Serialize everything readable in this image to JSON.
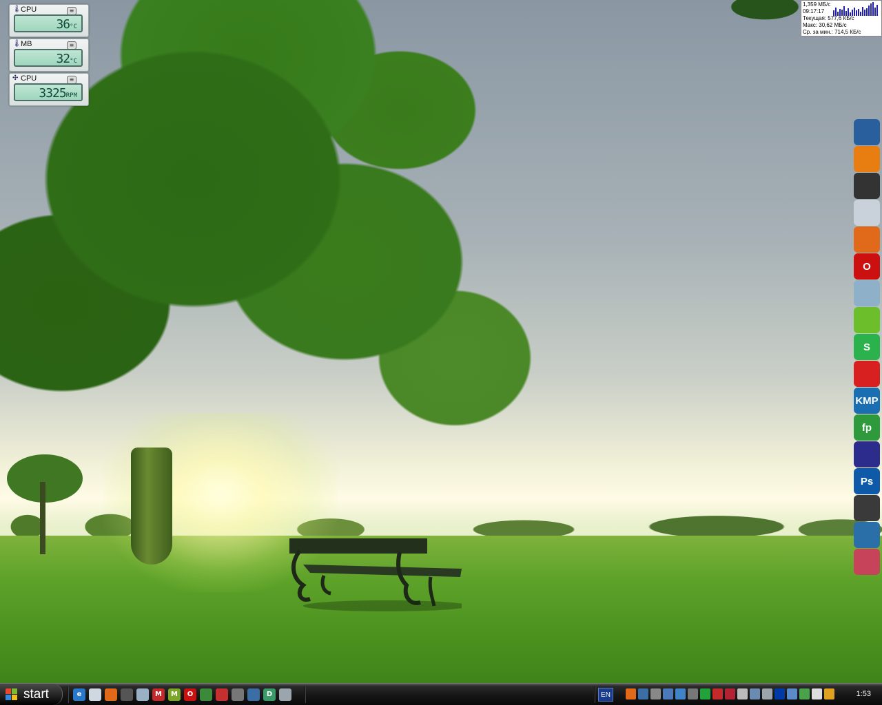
{
  "gadgets": [
    {
      "label": "CPU",
      "value": "36",
      "unit": "°C",
      "icon": "thermometer-icon"
    },
    {
      "label": "MB",
      "value": "32",
      "unit": "°C",
      "icon": "thermometer-icon"
    },
    {
      "label": "CPU",
      "value": "3325",
      "unit": "RPM",
      "icon": "fan-icon"
    }
  ],
  "netmeter": {
    "speed": "1,359 МБ/с",
    "time": "09:17:17",
    "current": "Текущая: 577,6 КБ/с",
    "max": "Макс: 30,62 МБ/с",
    "avg": "Ср. за мин.: 714,5 КБ/с"
  },
  "dock": [
    {
      "icon": "display-settings-icon",
      "color": "#2a5f9e",
      "text": ""
    },
    {
      "icon": "nero-icon",
      "color": "#e87d12",
      "text": ""
    },
    {
      "icon": "foobar-icon",
      "color": "#333333",
      "text": ""
    },
    {
      "icon": "ati-icon",
      "color": "#c9d1da",
      "text": ""
    },
    {
      "icon": "firefox-icon",
      "color": "#e06a1a",
      "text": ""
    },
    {
      "icon": "opera-icon",
      "color": "#cc1010",
      "text": "O"
    },
    {
      "icon": "file-manager-icon",
      "color": "#8fb0c9",
      "text": ""
    },
    {
      "icon": "utorrent-icon",
      "color": "#6cbf2a",
      "text": ""
    },
    {
      "icon": "skype-icon",
      "color": "#2bb24c",
      "text": "S"
    },
    {
      "icon": "burning-icon",
      "color": "#d92020",
      "text": ""
    },
    {
      "icon": "kmp-player-icon",
      "color": "#1a6fb2",
      "text": "KMP"
    },
    {
      "icon": "frontpage-icon",
      "color": "#2f9a3b",
      "text": "fp"
    },
    {
      "icon": "maxthon-icon",
      "color": "#2b2c8c",
      "text": ""
    },
    {
      "icon": "photoshop-icon",
      "color": "#0e5aa8",
      "text": "Ps"
    },
    {
      "icon": "video-editor-icon",
      "color": "#3a3a3a",
      "text": ""
    },
    {
      "icon": "settings-tool-icon",
      "color": "#2a6fa8",
      "text": ""
    },
    {
      "icon": "toolbox-icon",
      "color": "#c7435a",
      "text": ""
    }
  ],
  "taskbar": {
    "start_label": "start",
    "lang": "EN",
    "clock": "1:53",
    "quick_launch": [
      {
        "icon": "ie-icon",
        "color": "#2a78c9",
        "text": "e"
      },
      {
        "icon": "notepad-icon",
        "color": "#cfd8e0",
        "text": ""
      },
      {
        "icon": "firefox-icon",
        "color": "#e06a1a",
        "text": ""
      },
      {
        "icon": "winamp-icon",
        "color": "#555555",
        "text": ""
      },
      {
        "icon": "cloud-icon",
        "color": "#9ab0c4",
        "text": ""
      },
      {
        "icon": "mail-m-icon",
        "color": "#c42a2a",
        "text": "M"
      },
      {
        "icon": "mail-m-green-icon",
        "color": "#7ca62a",
        "text": "M"
      },
      {
        "icon": "opera-icon",
        "color": "#cc1010",
        "text": "O"
      },
      {
        "icon": "android-icon",
        "color": "#3a8a3a",
        "text": ""
      },
      {
        "icon": "library-icon",
        "color": "#c43030",
        "text": ""
      },
      {
        "icon": "tools-icon",
        "color": "#777777",
        "text": ""
      },
      {
        "icon": "network-icon",
        "color": "#3a6ea5",
        "text": ""
      },
      {
        "icon": "document-d-icon",
        "color": "#3a9a6a",
        "text": "D"
      },
      {
        "icon": "drive-icon",
        "color": "#9aa5ad",
        "text": ""
      }
    ],
    "tray": [
      {
        "icon": "firefox-tray-icon",
        "color": "#e06a1a"
      },
      {
        "icon": "network-tray-icon",
        "color": "#3a6ea5"
      },
      {
        "icon": "antivirus-tray-icon",
        "color": "#888888"
      },
      {
        "icon": "monitor-tray-icon",
        "color": "#4a7bb8"
      },
      {
        "icon": "display-tray-icon",
        "color": "#3f83c9"
      },
      {
        "icon": "sync-tray-icon",
        "color": "#777777"
      },
      {
        "icon": "green-p-tray-icon",
        "color": "#22a33a"
      },
      {
        "icon": "mail-tray-icon",
        "color": "#c42a2a"
      },
      {
        "icon": "flag-us-tray-icon",
        "color": "#b22234"
      },
      {
        "icon": "battery-tray-icon",
        "color": "#bbbbbb"
      },
      {
        "icon": "window-tray-icon",
        "color": "#6c8bb0"
      },
      {
        "icon": "disk-tray-icon",
        "color": "#9aa5ad"
      },
      {
        "icon": "flag-ru-tray-icon",
        "color": "#0039a6"
      },
      {
        "icon": "eye-tray-icon",
        "color": "#5a8ac9"
      },
      {
        "icon": "recycle-tray-icon",
        "color": "#4aa34a"
      },
      {
        "icon": "volume-tray-icon",
        "color": "#dddddd"
      },
      {
        "icon": "winamp-tray-icon",
        "color": "#e0a020"
      }
    ]
  }
}
